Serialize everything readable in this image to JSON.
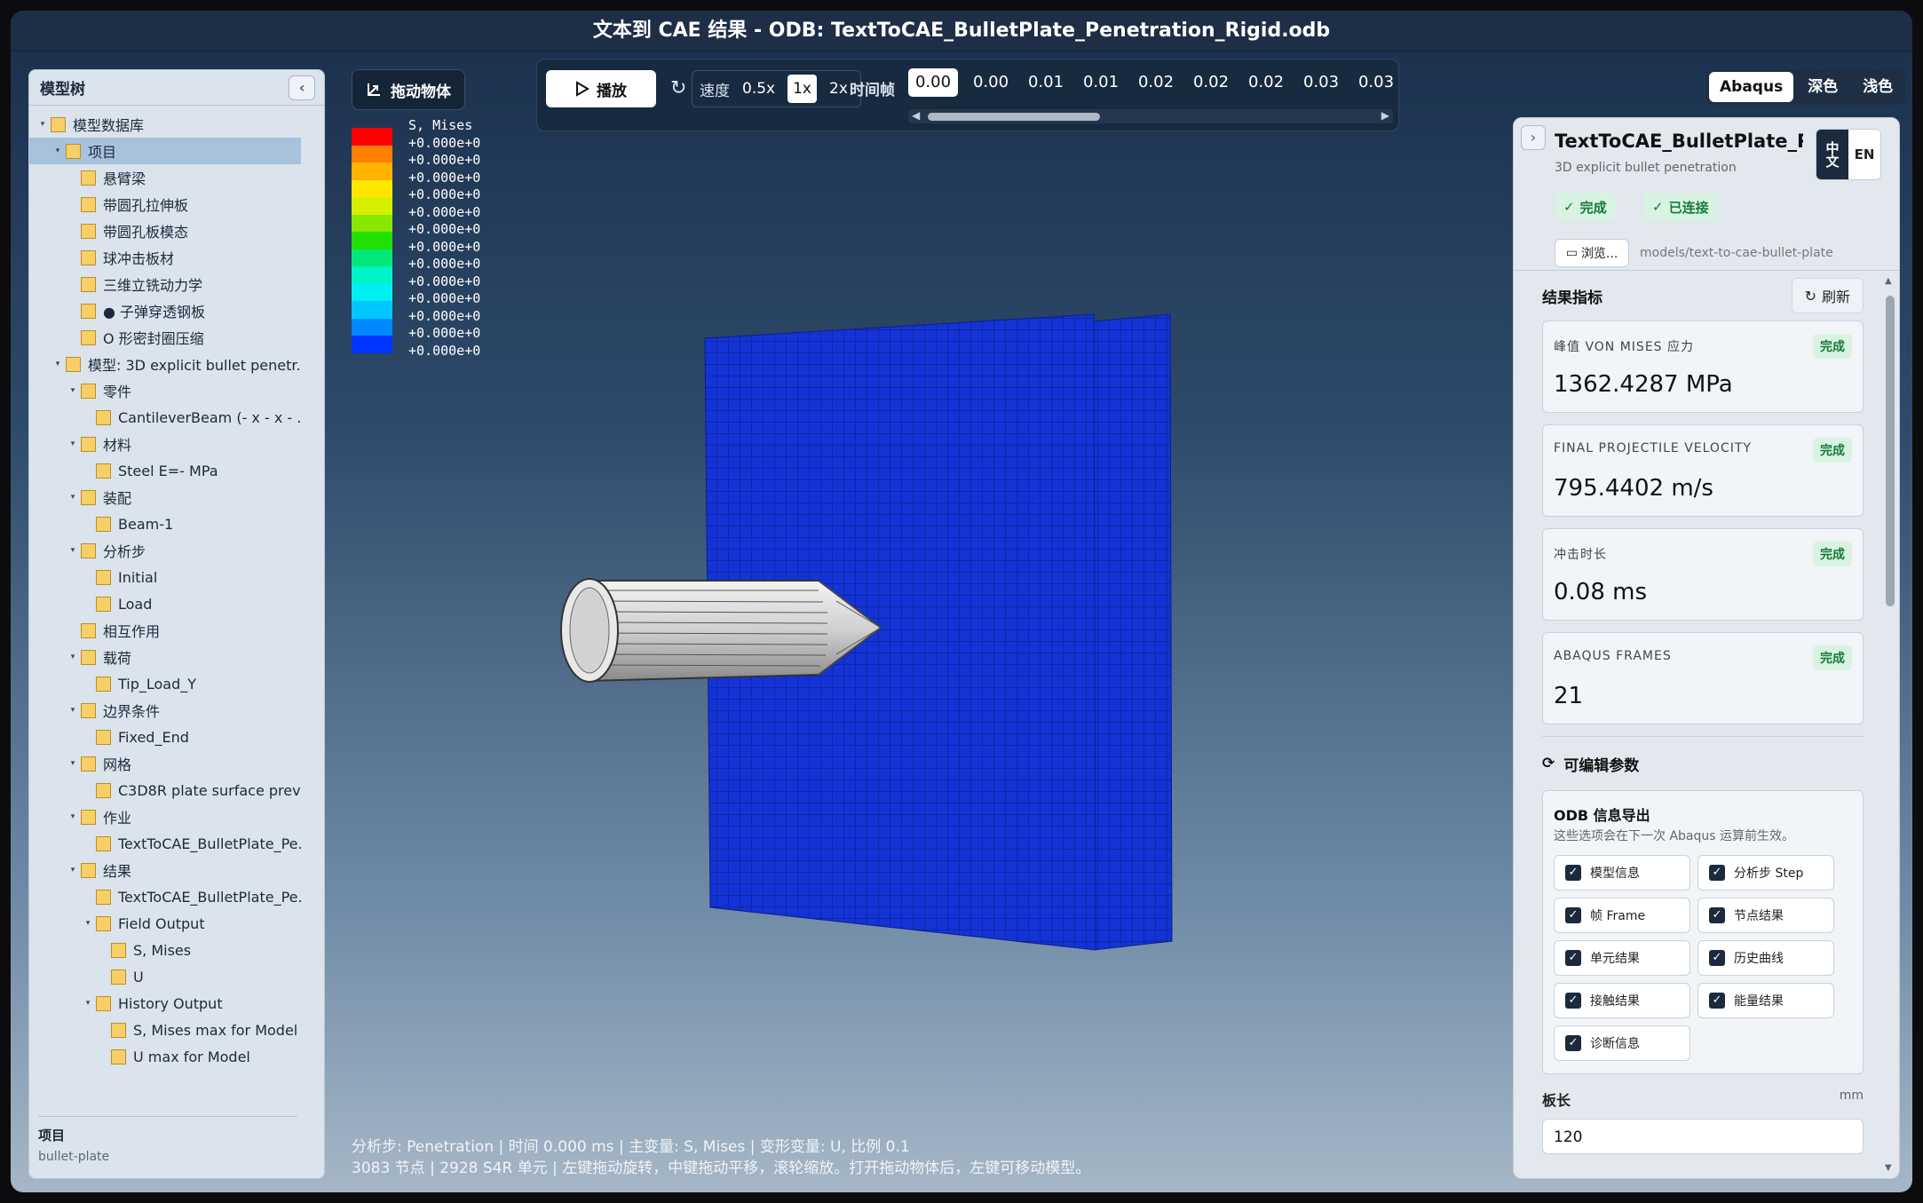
{
  "window": {
    "title": "文本到 CAE 结果 - ODB: TextToCAE_BulletPlate_Penetration_Rigid.odb"
  },
  "tree": {
    "title": "模型树",
    "collapse_icon": "‹",
    "rows": [
      {
        "label": "模型数据库",
        "indent": 0,
        "twisty": "▾"
      },
      {
        "label": "项目",
        "indent": 1,
        "twisty": "▾"
      },
      {
        "label": "悬臂梁",
        "indent": 2,
        "twisty": ""
      },
      {
        "label": "带圆孔拉伸板",
        "indent": 2,
        "twisty": ""
      },
      {
        "label": "带圆孔板模态",
        "indent": 2,
        "twisty": ""
      },
      {
        "label": "球冲击板材",
        "indent": 2,
        "twisty": ""
      },
      {
        "label": "三维立铣动力学",
        "indent": 2,
        "twisty": ""
      },
      {
        "label": "● 子弹穿透钢板",
        "indent": 2,
        "twisty": ""
      },
      {
        "label": "O 形密封圈压缩",
        "indent": 2,
        "twisty": ""
      },
      {
        "label": "模型: 3D explicit bullet penetr...",
        "indent": 1,
        "twisty": "▾"
      },
      {
        "label": "零件",
        "indent": 2,
        "twisty": "▾"
      },
      {
        "label": "CantileverBeam (- x - x - ...",
        "indent": 3,
        "twisty": ""
      },
      {
        "label": "材料",
        "indent": 2,
        "twisty": "▾"
      },
      {
        "label": "Steel E=- MPa",
        "indent": 3,
        "twisty": ""
      },
      {
        "label": "装配",
        "indent": 2,
        "twisty": "▾"
      },
      {
        "label": "Beam-1",
        "indent": 3,
        "twisty": ""
      },
      {
        "label": "分析步",
        "indent": 2,
        "twisty": "▾"
      },
      {
        "label": "Initial",
        "indent": 3,
        "twisty": ""
      },
      {
        "label": "Load",
        "indent": 3,
        "twisty": ""
      },
      {
        "label": "相互作用",
        "indent": 2,
        "twisty": ""
      },
      {
        "label": "载荷",
        "indent": 2,
        "twisty": "▾"
      },
      {
        "label": "Tip_Load_Y",
        "indent": 3,
        "twisty": ""
      },
      {
        "label": "边界条件",
        "indent": 2,
        "twisty": "▾"
      },
      {
        "label": "Fixed_End",
        "indent": 3,
        "twisty": ""
      },
      {
        "label": "网格",
        "indent": 2,
        "twisty": "▾"
      },
      {
        "label": "C3D8R plate surface prev...",
        "indent": 3,
        "twisty": ""
      },
      {
        "label": "作业",
        "indent": 2,
        "twisty": "▾"
      },
      {
        "label": "TextToCAE_BulletPlate_Pe...",
        "indent": 3,
        "twisty": ""
      },
      {
        "label": "结果",
        "indent": 2,
        "twisty": "▾"
      },
      {
        "label": "TextToCAE_BulletPlate_Pe...",
        "indent": 3,
        "twisty": ""
      },
      {
        "label": "Field Output",
        "indent": 3,
        "twisty": "▾"
      },
      {
        "label": "S, Mises",
        "indent": 4,
        "twisty": ""
      },
      {
        "label": "U",
        "indent": 4,
        "twisty": ""
      },
      {
        "label": "History Output",
        "indent": 3,
        "twisty": "▾"
      },
      {
        "label": "S, Mises max for Model",
        "indent": 4,
        "twisty": ""
      },
      {
        "label": "U max for Model",
        "indent": 4,
        "twisty": ""
      }
    ],
    "selected_index": 1,
    "footer": {
      "title": "项目",
      "value": "bullet-plate"
    }
  },
  "viewport": {
    "drag_button": "拖动物体",
    "legend": {
      "title": "S, Mises",
      "values": [
        "+0.000e+0",
        "+0.000e+0",
        "+0.000e+0",
        "+0.000e+0",
        "+0.000e+0",
        "+0.000e+0",
        "+0.000e+0",
        "+0.000e+0",
        "+0.000e+0",
        "+0.000e+0",
        "+0.000e+0",
        "+0.000e+0",
        "+0.000e+0"
      ],
      "colors": [
        "#ff0000",
        "#ff7f00",
        "#ffb200",
        "#ffe600",
        "#d4f000",
        "#88e600",
        "#22e000",
        "#00e87a",
        "#00f2c8",
        "#00f0f0",
        "#00c8ff",
        "#0088ff",
        "#0036ff"
      ]
    },
    "status_line1": "分析步:  Penetration | 时间 0.000 ms | 主变量: S, Mises | 变形变量: U, 比例 0.1",
    "status_line2": "3083 节点 | 2928 S4R 单元 | 左键拖动旋转，中键拖动平移，滚轮缩放。打开拖动物体后，左键可移动模型。"
  },
  "player": {
    "play_label": "播放",
    "speed_label": "速度",
    "speeds": [
      "0.5x",
      "1x",
      "2x"
    ],
    "active_speed": "1x",
    "frames_label": "时间帧",
    "frames": [
      "0.00",
      "0.00",
      "0.01",
      "0.01",
      "0.02",
      "0.02",
      "0.02",
      "0.03",
      "0.03"
    ],
    "active_frame": 0
  },
  "theme": {
    "options": [
      "Abaqus",
      "深色",
      "浅色"
    ],
    "active": "Abaqus"
  },
  "right_panel": {
    "title": "TextToCAE_BulletPlate_Pen...",
    "subtitle": "3D explicit bullet penetration",
    "lang": {
      "zh": "中文",
      "en": "EN"
    },
    "badge_done": "完成",
    "badge_connected": "已连接",
    "browse_label": "浏览...",
    "browse_path": "models/text-to-cae-bullet-plate",
    "metrics_title": "结果指标",
    "refresh_label": "刷新",
    "metrics": [
      {
        "label": "峰值 VON MISES 应力",
        "status": "完成",
        "value": "1362.4287 MPa"
      },
      {
        "label": "FINAL PROJECTILE VELOCITY",
        "status": "完成",
        "value": "795.4402 m/s"
      },
      {
        "label": "冲击时长",
        "status": "完成",
        "value": "0.08 ms"
      },
      {
        "label": "ABAQUS FRAMES",
        "status": "完成",
        "value": "21"
      }
    ],
    "editable_title": "可编辑参数",
    "odb": {
      "title": "ODB 信息导出",
      "note": "这些选项会在下一次 Abaqus 运算前生效。",
      "options": [
        "模型信息",
        "分析步 Step",
        "帧 Frame",
        "节点结果",
        "单元结果",
        "历史曲线",
        "接触结果",
        "能量结果",
        "诊断信息"
      ]
    },
    "plate_length": {
      "label": "板长",
      "unit": "mm",
      "value": "120"
    }
  }
}
